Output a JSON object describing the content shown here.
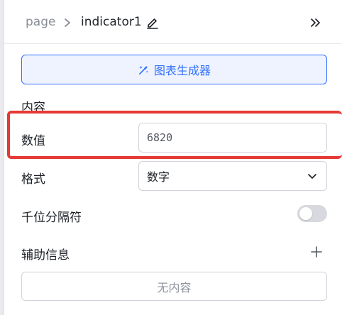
{
  "breadcrumb": {
    "root": "page",
    "current": "indicator1"
  },
  "icons": {
    "separator": "chevron-right-icon",
    "edit": "pencil-icon",
    "collapse": "double-chevron-right-icon",
    "generator": "magic-wand-icon",
    "select": "chevron-down-icon",
    "add": "plus-icon"
  },
  "toolbar": {
    "generator_label": "图表生成器"
  },
  "content_section": {
    "title": "内容",
    "value_label": "数值",
    "value": "6820",
    "format_label": "格式",
    "format_selected": "数字",
    "thousands_label": "千位分隔符",
    "thousands_enabled": false,
    "aux_label": "辅助信息",
    "aux_empty": "无内容"
  },
  "colors": {
    "accent": "#3370ff",
    "highlight": "#e53935"
  }
}
